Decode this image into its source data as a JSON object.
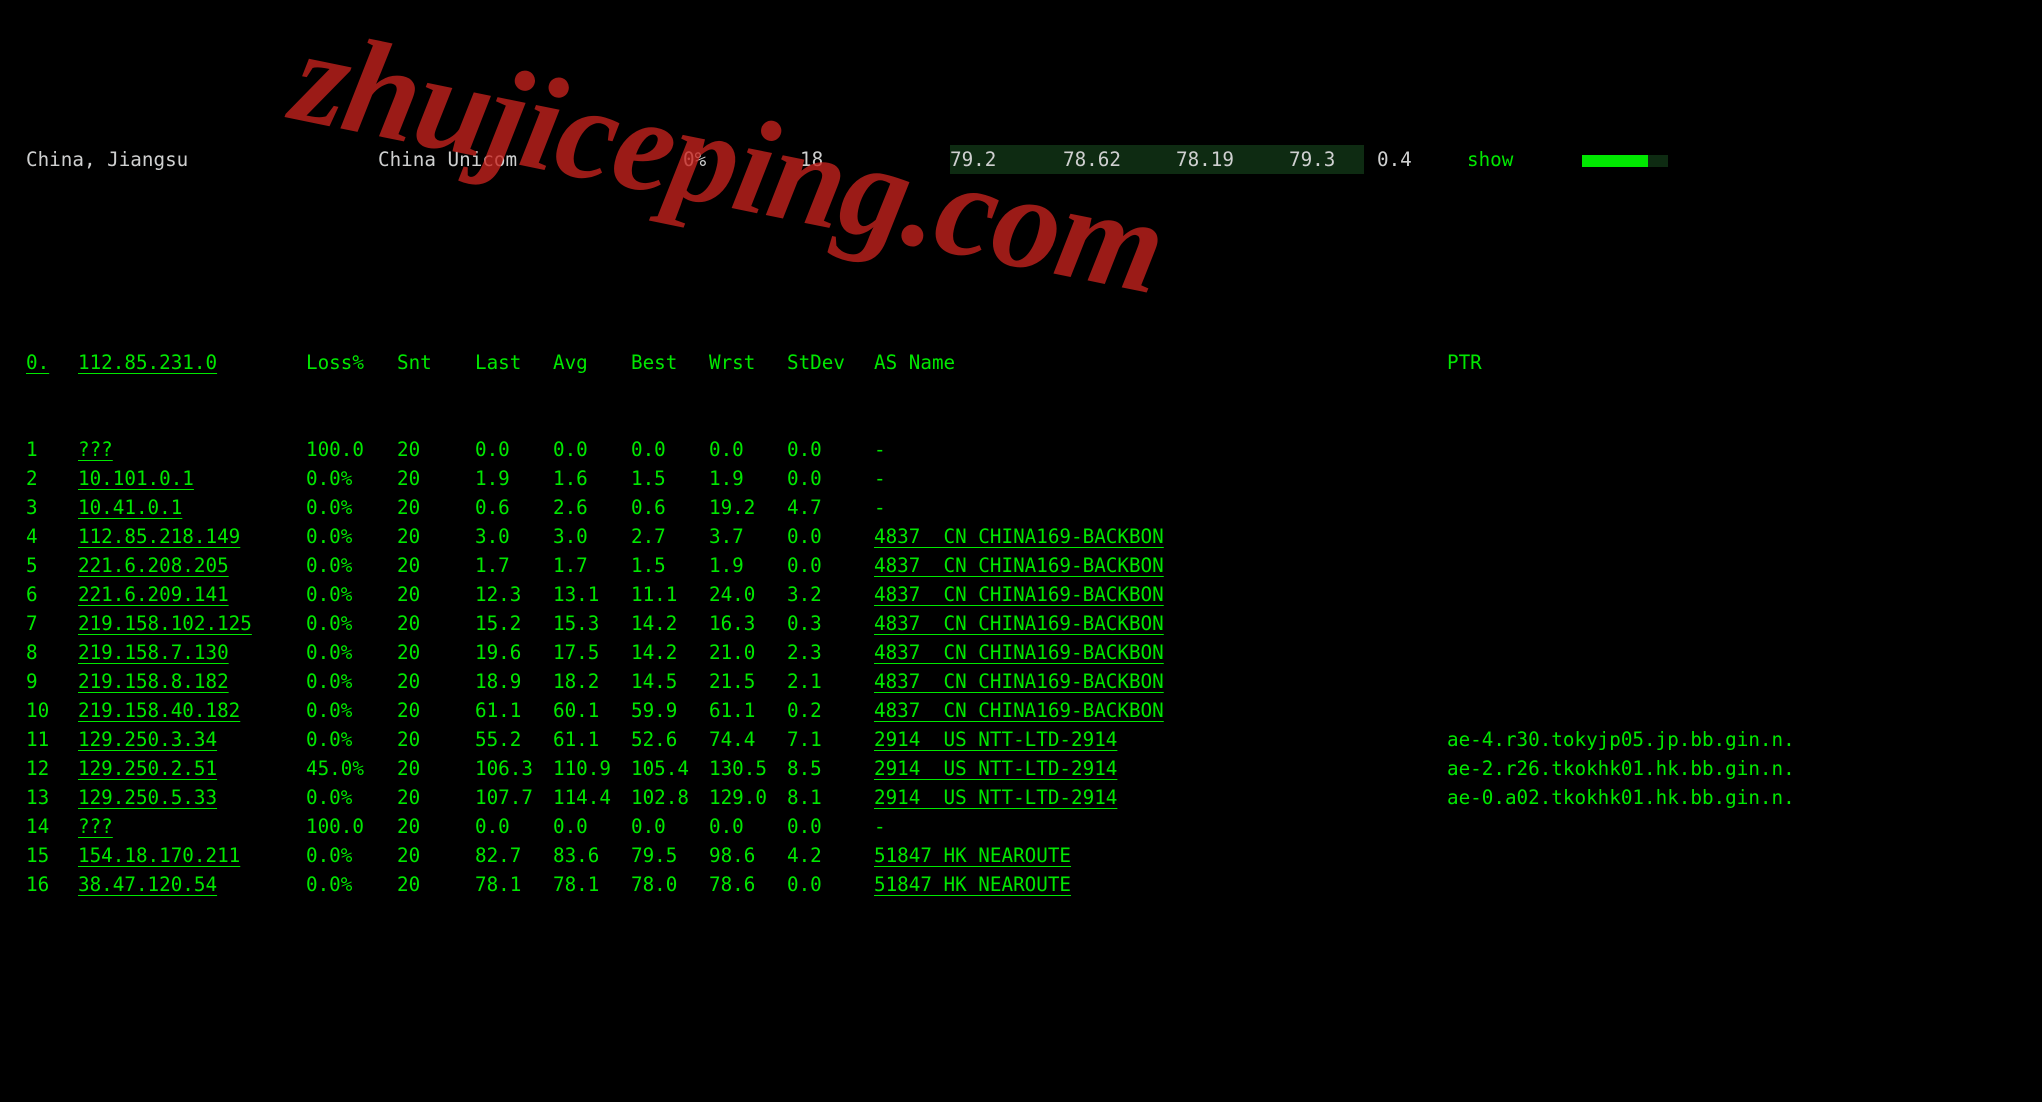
{
  "topbar": {
    "location": "China, Jiangsu",
    "isp": "China Unicom",
    "m1": "0%",
    "m2": "18",
    "m3": "79.2",
    "m4": "78.62",
    "m5": "78.19",
    "m6": "79.3",
    "m7": "0.4",
    "show": "show"
  },
  "headers": {
    "hop": "0.",
    "ip": "112.85.231.0",
    "loss": "Loss%",
    "snt": "Snt",
    "last": "Last",
    "avg": "Avg",
    "best": "Best",
    "wrst": "Wrst",
    "stdev": "StDev",
    "as": "AS Name",
    "ptr": "PTR"
  },
  "rows": [
    {
      "hop": "1",
      "ip": "???",
      "loss": "100.0",
      "snt": "20",
      "last": "0.0",
      "avg": "0.0",
      "best": "0.0",
      "wrst": "0.0",
      "stdev": "0.0",
      "as": "-",
      "ptr": ""
    },
    {
      "hop": "2",
      "ip": "10.101.0.1",
      "loss": "0.0%",
      "snt": "20",
      "last": "1.9",
      "avg": "1.6",
      "best": "1.5",
      "wrst": "1.9",
      "stdev": "0.0",
      "as": "-",
      "ptr": ""
    },
    {
      "hop": "3",
      "ip": "10.41.0.1",
      "loss": "0.0%",
      "snt": "20",
      "last": "0.6",
      "avg": "2.6",
      "best": "0.6",
      "wrst": "19.2",
      "stdev": "4.7",
      "as": "-",
      "ptr": ""
    },
    {
      "hop": "4",
      "ip": "112.85.218.149",
      "loss": "0.0%",
      "snt": "20",
      "last": "3.0",
      "avg": "3.0",
      "best": "2.7",
      "wrst": "3.7",
      "stdev": "0.0",
      "as": "4837  CN CHINA169-BACKBON",
      "ptr": ""
    },
    {
      "hop": "5",
      "ip": "221.6.208.205",
      "loss": "0.0%",
      "snt": "20",
      "last": "1.7",
      "avg": "1.7",
      "best": "1.5",
      "wrst": "1.9",
      "stdev": "0.0",
      "as": "4837  CN CHINA169-BACKBON",
      "ptr": ""
    },
    {
      "hop": "6",
      "ip": "221.6.209.141",
      "loss": "0.0%",
      "snt": "20",
      "last": "12.3",
      "avg": "13.1",
      "best": "11.1",
      "wrst": "24.0",
      "stdev": "3.2",
      "as": "4837  CN CHINA169-BACKBON",
      "ptr": ""
    },
    {
      "hop": "7",
      "ip": "219.158.102.125",
      "loss": "0.0%",
      "snt": "20",
      "last": "15.2",
      "avg": "15.3",
      "best": "14.2",
      "wrst": "16.3",
      "stdev": "0.3",
      "as": "4837  CN CHINA169-BACKBON",
      "ptr": ""
    },
    {
      "hop": "8",
      "ip": "219.158.7.130",
      "loss": "0.0%",
      "snt": "20",
      "last": "19.6",
      "avg": "17.5",
      "best": "14.2",
      "wrst": "21.0",
      "stdev": "2.3",
      "as": "4837  CN CHINA169-BACKBON",
      "ptr": ""
    },
    {
      "hop": "9",
      "ip": "219.158.8.182",
      "loss": "0.0%",
      "snt": "20",
      "last": "18.9",
      "avg": "18.2",
      "best": "14.5",
      "wrst": "21.5",
      "stdev": "2.1",
      "as": "4837  CN CHINA169-BACKBON",
      "ptr": ""
    },
    {
      "hop": "10",
      "ip": "219.158.40.182",
      "loss": "0.0%",
      "snt": "20",
      "last": "61.1",
      "avg": "60.1",
      "best": "59.9",
      "wrst": "61.1",
      "stdev": "0.2",
      "as": "4837  CN CHINA169-BACKBON",
      "ptr": ""
    },
    {
      "hop": "11",
      "ip": "129.250.3.34",
      "loss": "0.0%",
      "snt": "20",
      "last": "55.2",
      "avg": "61.1",
      "best": "52.6",
      "wrst": "74.4",
      "stdev": "7.1",
      "as": "2914  US NTT-LTD-2914",
      "ptr": "ae-4.r30.tokyjp05.jp.bb.gin.n."
    },
    {
      "hop": "12",
      "ip": "129.250.2.51",
      "loss": "45.0%",
      "snt": "20",
      "last": "106.3",
      "avg": "110.9",
      "best": "105.4",
      "wrst": "130.5",
      "stdev": "8.5",
      "as": "2914  US NTT-LTD-2914",
      "ptr": "ae-2.r26.tkokhk01.hk.bb.gin.n."
    },
    {
      "hop": "13",
      "ip": "129.250.5.33",
      "loss": "0.0%",
      "snt": "20",
      "last": "107.7",
      "avg": "114.4",
      "best": "102.8",
      "wrst": "129.0",
      "stdev": "8.1",
      "as": "2914  US NTT-LTD-2914",
      "ptr": "ae-0.a02.tkokhk01.hk.bb.gin.n."
    },
    {
      "hop": "14",
      "ip": "???",
      "loss": "100.0",
      "snt": "20",
      "last": "0.0",
      "avg": "0.0",
      "best": "0.0",
      "wrst": "0.0",
      "stdev": "0.0",
      "as": "-",
      "ptr": ""
    },
    {
      "hop": "15",
      "ip": "154.18.170.211",
      "loss": "0.0%",
      "snt": "20",
      "last": "82.7",
      "avg": "83.6",
      "best": "79.5",
      "wrst": "98.6",
      "stdev": "4.2",
      "as": "51847 HK NEAROUTE",
      "ptr": ""
    },
    {
      "hop": "16",
      "ip": "38.47.120.54",
      "loss": "0.0%",
      "snt": "20",
      "last": "78.1",
      "avg": "78.1",
      "best": "78.0",
      "wrst": "78.6",
      "stdev": "0.0",
      "as": "51847 HK NEAROUTE",
      "ptr": ""
    }
  ],
  "watermark": "zhujiceping.com"
}
